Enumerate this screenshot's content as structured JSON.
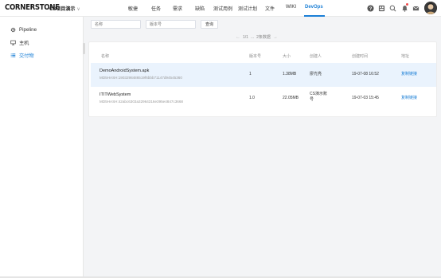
{
  "header": {
    "brand": "CORNERSTONE",
    "project": "CS项目演示",
    "project_chevron": "∨",
    "nav": [
      {
        "label": "敏捷",
        "active": false
      },
      {
        "label": "任务",
        "active": false
      },
      {
        "label": "需求",
        "active": false
      },
      {
        "label": "缺陷",
        "active": false
      },
      {
        "label": "测试用例",
        "active": false
      },
      {
        "label": "测试计划",
        "active": false
      },
      {
        "label": "文件",
        "active": false
      },
      {
        "label": "WIKI",
        "active": false
      },
      {
        "label": "DevOps",
        "active": true
      }
    ],
    "right_icons": [
      "help-icon",
      "dashboard-icon",
      "search-icon",
      "bell-icon",
      "mail-icon"
    ],
    "accent": "#1b7fd6"
  },
  "sidebar": {
    "items": [
      {
        "label": "Pipeline",
        "icon": "gear-icon",
        "active": false
      },
      {
        "label": "主机",
        "icon": "monitor-icon",
        "active": false
      },
      {
        "label": "交付物",
        "icon": "list-icon",
        "active": true
      }
    ]
  },
  "filters": {
    "name_placeholder": "名称",
    "version_placeholder": "版本号",
    "query_label": "查询"
  },
  "pagination": {
    "prev": "←",
    "text": "1/1",
    "ellipsis": "...",
    "total": "2条数据",
    "next": "→"
  },
  "table": {
    "columns": [
      "名称",
      "版本号",
      "大小",
      "创建人",
      "创建时间",
      "地址"
    ],
    "rows": [
      {
        "name": "DemoAndroidSystem.apk",
        "hash": "MD5HASH:1903298486519f6bbb71147d94545360",
        "version": "1",
        "size": "1.38MB",
        "creator": "廖光亮",
        "created": "19-07-08 16:52",
        "address": "复制链接",
        "highlighted": true
      },
      {
        "name": "ITITWebSystem",
        "hash": "MD5HASH:42abc6303a32964316e395e4847c3668",
        "version": "1.0",
        "size": "22.05MB",
        "creator": "CS演示账号",
        "created": "19-07-03 15:45",
        "address": "复制链接",
        "highlighted": false
      }
    ]
  }
}
